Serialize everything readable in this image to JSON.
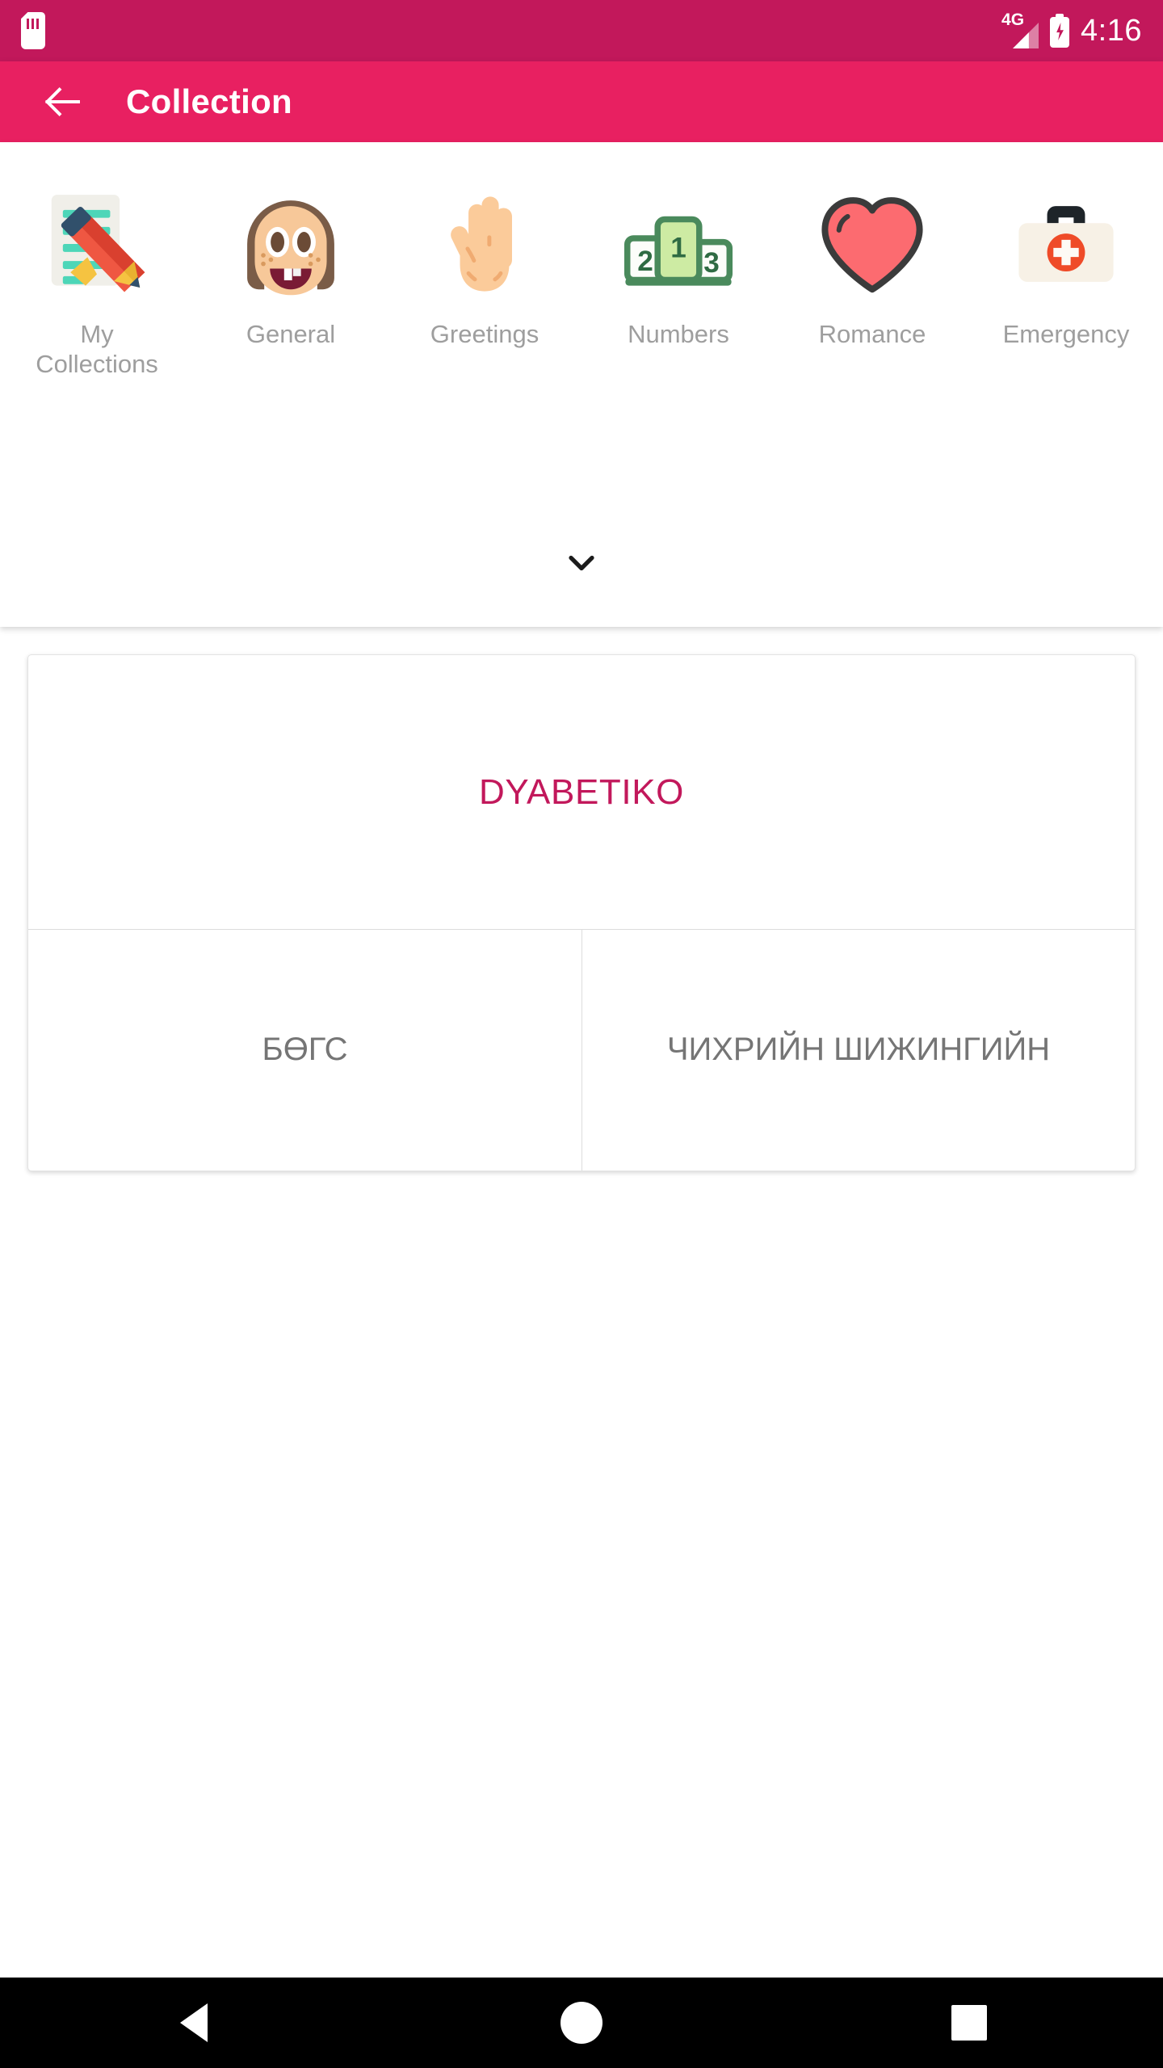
{
  "status_bar": {
    "background": "#C2185B",
    "sd_card_icon": "sd-card-icon",
    "network_label": "4G",
    "signal_icon": "signal-bars-icon",
    "battery_icon": "battery-charging-icon",
    "time": "4:16"
  },
  "app_bar": {
    "background": "#E82061",
    "back_icon": "back-arrow-icon",
    "title": "Collection"
  },
  "categories": {
    "expand_icon": "chevron-down-icon",
    "items": [
      {
        "label": "My Collections",
        "icon": "memo-pencil-icon"
      },
      {
        "label": "General",
        "icon": "girl-face-icon"
      },
      {
        "label": "Greetings",
        "icon": "open-hand-icon"
      },
      {
        "label": "Numbers",
        "icon": "podium-123-icon"
      },
      {
        "label": "Romance",
        "icon": "heart-icon"
      },
      {
        "label": "Emergency",
        "icon": "first-aid-kit-icon"
      }
    ]
  },
  "translation_card": {
    "source_text": "DYABETIKO",
    "source_color": "#C2185B",
    "targets": [
      {
        "text": "БӨГС"
      },
      {
        "text": "ЧИХРИЙН ШИЖИНГИЙН"
      }
    ]
  },
  "nav_bar": {
    "background": "#000000",
    "back_icon": "nav-back-triangle-icon",
    "home_icon": "nav-home-circle-icon",
    "recents_icon": "nav-recents-square-icon"
  }
}
